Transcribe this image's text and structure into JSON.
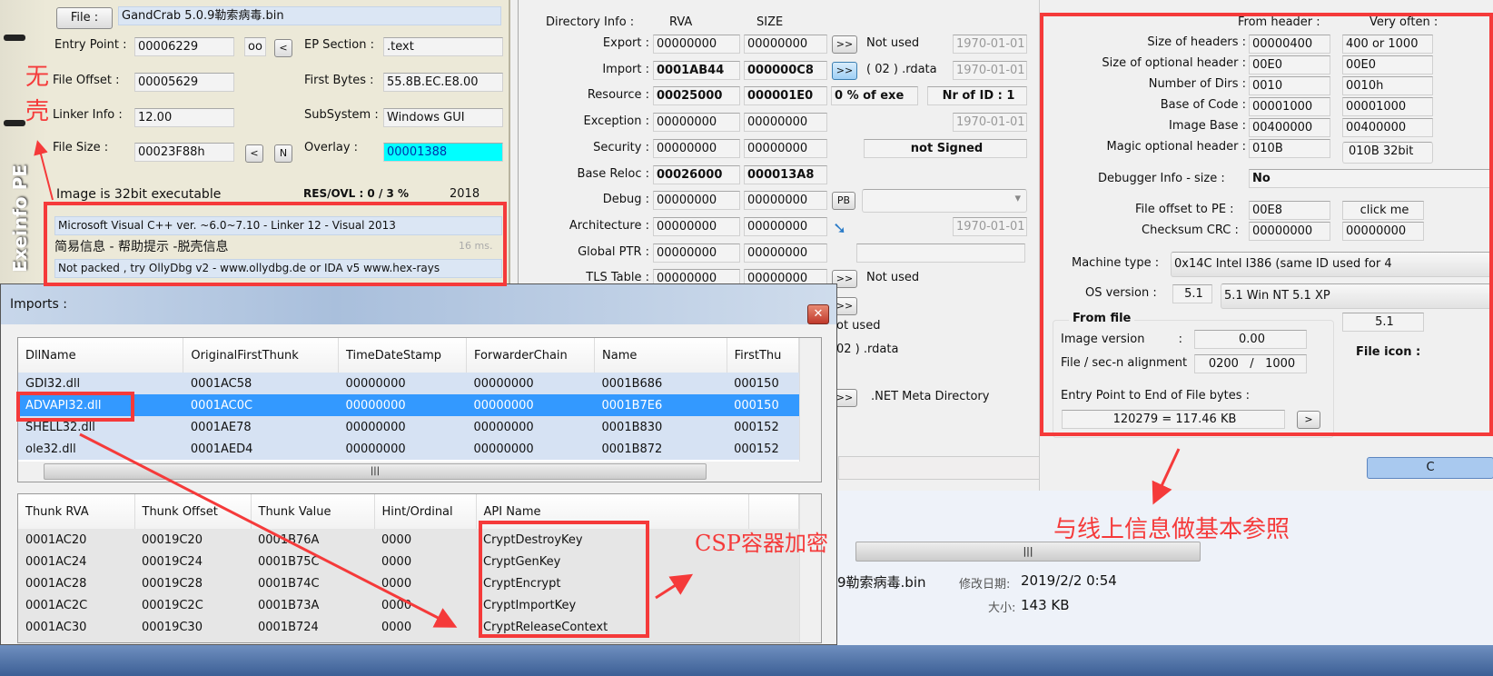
{
  "exeinfo": {
    "brand": "Exeinfo PE",
    "file_button": "File :",
    "file_name": "GandCrab 5.0.9勒索病毒.bin",
    "entry_point_label": "Entry Point :",
    "entry_point": "00006229",
    "oo_button": "oo",
    "lt_button": "<",
    "ep_section_label": "EP Section :",
    "ep_section": ".text",
    "file_offset_label": "File Offset :",
    "file_offset": "00005629",
    "first_bytes_label": "First Bytes :",
    "first_bytes": "55.8B.EC.E8.00",
    "linker_label": "Linker Info :",
    "linker": "12.00",
    "subsystem_label": "SubSystem :",
    "subsystem": "Windows GUI",
    "file_size_label": "File Size :",
    "file_size": "00023F88h",
    "n_button": "N",
    "overlay_label": "Overlay :",
    "overlay": "00001388",
    "overlay_color": "#00ffff",
    "image_bits": "Image is 32bit executable",
    "res_ovl": "RES/OVL : 0 / 3 %",
    "year": "2018",
    "detect": "Microsoft Visual C++ ver. ~6.0~7.10 - Linker 12 - Visual 2013",
    "info_links": "简易信息 - 帮助提示 -脱壳信息",
    "time": "16 ms.",
    "hint": "Not packed , try OllyDbg v2 - www.ollydbg.de or IDA v5 www.hex-rays"
  },
  "directory": {
    "title": "Directory Info :",
    "rva_header": "RVA",
    "size_header": "SIZE",
    "rows": [
      {
        "label": "Export :",
        "rva": "00000000",
        "size": "00000000",
        "note": "Not used",
        "date": "1970-01-01"
      },
      {
        "label": "Import :",
        "rva": "0001AB44",
        "size": "000000C8",
        "note": "( 02 ) .rdata",
        "date": "1970-01-01"
      },
      {
        "label": "Resource :",
        "rva": "00025000",
        "size": "000001E0",
        "note": "0  % of exe",
        "date": "Nr of ID : 1"
      },
      {
        "label": "Exception :",
        "rva": "00000000",
        "size": "00000000",
        "note": "",
        "date": "1970-01-01"
      },
      {
        "label": "Security :",
        "rva": "00000000",
        "size": "00000000",
        "note": "not Signed",
        "date": ""
      },
      {
        "label": "Base Reloc :",
        "rva": "00026000",
        "size": "000013A8",
        "note": "",
        "date": ""
      },
      {
        "label": "Debug :",
        "rva": "00000000",
        "size": "00000000",
        "note": "PB",
        "date": ""
      },
      {
        "label": "Architecture :",
        "rva": "00000000",
        "size": "00000000",
        "note": "",
        "date": "1970-01-01"
      },
      {
        "label": "Global PTR :",
        "rva": "00000000",
        "size": "00000000",
        "note": "",
        "date": ""
      },
      {
        "label": "TLS Table :",
        "rva": "00000000",
        "size": "00000000",
        "note": "Not used",
        "date": ""
      }
    ],
    "behind": {
      "not_used": "ot used",
      "rdata": "02 ) .rdata",
      "net_meta": ".NET Meta Directory",
      "btn": ">>"
    }
  },
  "header": {
    "from_header": "From header :",
    "very_often": "Very often :",
    "rows": [
      {
        "label": "Size of headers :",
        "value": "00000400",
        "often": "400 or  1000"
      },
      {
        "label": "Size of optional header :",
        "value": "00E0",
        "often": "00E0"
      },
      {
        "label": "Number of Dirs :",
        "value": "0010",
        "often": "0010h"
      },
      {
        "label": "Base of Code :",
        "value": "00001000",
        "often": "00001000"
      },
      {
        "label": "Image Base :",
        "value": "00400000",
        "often": "00400000"
      },
      {
        "label": "Magic optional header :",
        "value": "010B",
        "often": "010B 32bit"
      }
    ],
    "debugger_label": "Debugger Info  -  size :",
    "debugger": "No",
    "pe_offset_label": "File offset to PE :",
    "pe_offset": "00E8",
    "click_me": "click me",
    "checksum_label": "Checksum CRC :",
    "checksum": "00000000",
    "checksum2": "00000000",
    "machine_label": "Machine type :",
    "machine": "0x14C    Intel I386 (same ID used for 4",
    "os_label": "OS version :",
    "os": "5.1",
    "os_name": "5.1   Win NT 5.1 XP",
    "os2": "5.1",
    "from_file": "From file",
    "image_version_label": "Image version         :",
    "image_version": "0.00",
    "align_label": "File / sec-n alignment  :",
    "align": "0200   /   1000",
    "ep_end_label": "Entry Point to End of File bytes :",
    "ep_end": "120279  =  117.46 KB",
    "go": ">",
    "file_icon": "File icon :",
    "ok": "C"
  },
  "imports": {
    "title": "Imports :",
    "dll_columns": [
      "DllName",
      "OriginalFirstThunk",
      "TimeDateStamp",
      "ForwarderChain",
      "Name",
      "FirstThu"
    ],
    "dlls": [
      [
        "GDI32.dll",
        "0001AC58",
        "00000000",
        "00000000",
        "0001B686",
        "000150"
      ],
      [
        "ADVAPI32.dll",
        "0001AC0C",
        "00000000",
        "00000000",
        "0001B7E6",
        "000150"
      ],
      [
        "SHELL32.dll",
        "0001AE78",
        "00000000",
        "00000000",
        "0001B830",
        "000152"
      ],
      [
        "ole32.dll",
        "0001AED4",
        "00000000",
        "00000000",
        "0001B872",
        "000152"
      ]
    ],
    "selected": 1,
    "api_columns": [
      "Thunk RVA",
      "Thunk Offset",
      "Thunk Value",
      "Hint/Ordinal",
      "API Name"
    ],
    "apis": [
      [
        "0001AC20",
        "00019C20",
        "0001B76A",
        "0000",
        "CryptDestroyKey"
      ],
      [
        "0001AC24",
        "00019C24",
        "0001B75C",
        "0000",
        "CryptGenKey"
      ],
      [
        "0001AC28",
        "00019C28",
        "0001B74C",
        "0000",
        "CryptEncrypt"
      ],
      [
        "0001AC2C",
        "00019C2C",
        "0001B73A",
        "0000",
        "CryptImportKey"
      ],
      [
        "0001AC30",
        "00019C30",
        "0001B724",
        "0000",
        "CryptReleaseContext"
      ]
    ]
  },
  "explorer": {
    "file": "9勒索病毒.bin",
    "modified_label": "修改日期:",
    "modified": "2019/2/2 0:54",
    "size_label": "大小:",
    "size": "143 KB"
  },
  "annotations": {
    "no_pack": "无壳",
    "no_pack2": "壳",
    "csp": "CSP容器加密",
    "reference": "与线上信息做基本参照",
    "color": "#f53a3a"
  }
}
